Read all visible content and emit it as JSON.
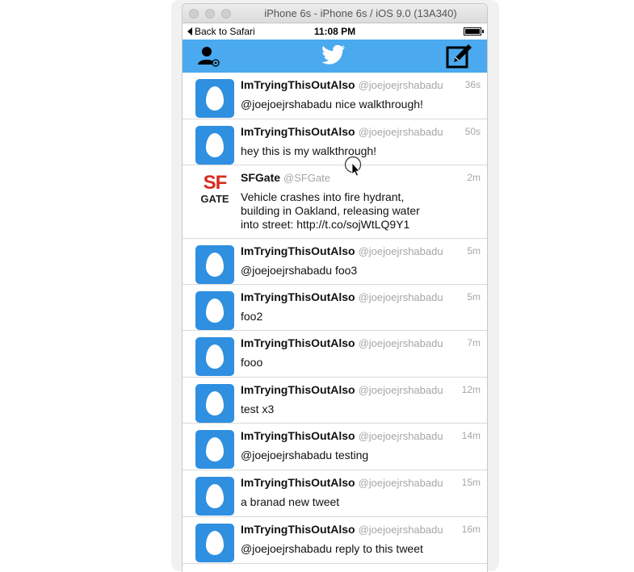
{
  "window": {
    "title": "iPhone 6s - iPhone 6s / iOS 9.0 (13A340)"
  },
  "status_bar": {
    "back_label": "Back to Safari",
    "time": "11:08 PM"
  },
  "nav": {
    "left_icon": "profile-icon",
    "center_icon": "twitter-bird-icon",
    "right_icon": "compose-icon",
    "color": "#4aa9ef"
  },
  "tweets": [
    {
      "name": "ImTryingThisOutAlso",
      "handle": "@joejoejrshabadu",
      "time": "36s",
      "text": "@joejoejrshabadu nice walkthrough!",
      "avatar": "egg"
    },
    {
      "name": "ImTryingThisOutAlso",
      "handle": "@joejoejrshabadu",
      "time": "50s",
      "text": "hey this is my walkthrough!",
      "avatar": "egg"
    },
    {
      "name": "SFGate",
      "handle": "@SFGate",
      "time": "2m",
      "text": "Vehicle crashes into fire hydrant, building in Oakland, releasing water into street: http://t.co/sojWtLQ9Y1",
      "avatar": "sfgate",
      "logo_top": "SF",
      "logo_bottom": "GATE"
    },
    {
      "name": "ImTryingThisOutAlso",
      "handle": "@joejoejrshabadu",
      "time": "5m",
      "text": "@joejoejrshabadu foo3",
      "avatar": "egg"
    },
    {
      "name": "ImTryingThisOutAlso",
      "handle": "@joejoejrshabadu",
      "time": "5m",
      "text": "foo2",
      "avatar": "egg"
    },
    {
      "name": "ImTryingThisOutAlso",
      "handle": "@joejoejrshabadu",
      "time": "7m",
      "text": "fooo",
      "avatar": "egg"
    },
    {
      "name": "ImTryingThisOutAlso",
      "handle": "@joejoejrshabadu",
      "time": "12m",
      "text": "test x3",
      "avatar": "egg"
    },
    {
      "name": "ImTryingThisOutAlso",
      "handle": "@joejoejrshabadu",
      "time": "14m",
      "text": "@joejoejrshabadu testing",
      "avatar": "egg"
    },
    {
      "name": "ImTryingThisOutAlso",
      "handle": "@joejoejrshabadu",
      "time": "15m",
      "text": "a branad new tweet",
      "avatar": "egg"
    },
    {
      "name": "ImTryingThisOutAlso",
      "handle": "@joejoejrshabadu",
      "time": "16m",
      "text": "@joejoejrshabadu reply to this tweet",
      "avatar": "egg"
    }
  ]
}
